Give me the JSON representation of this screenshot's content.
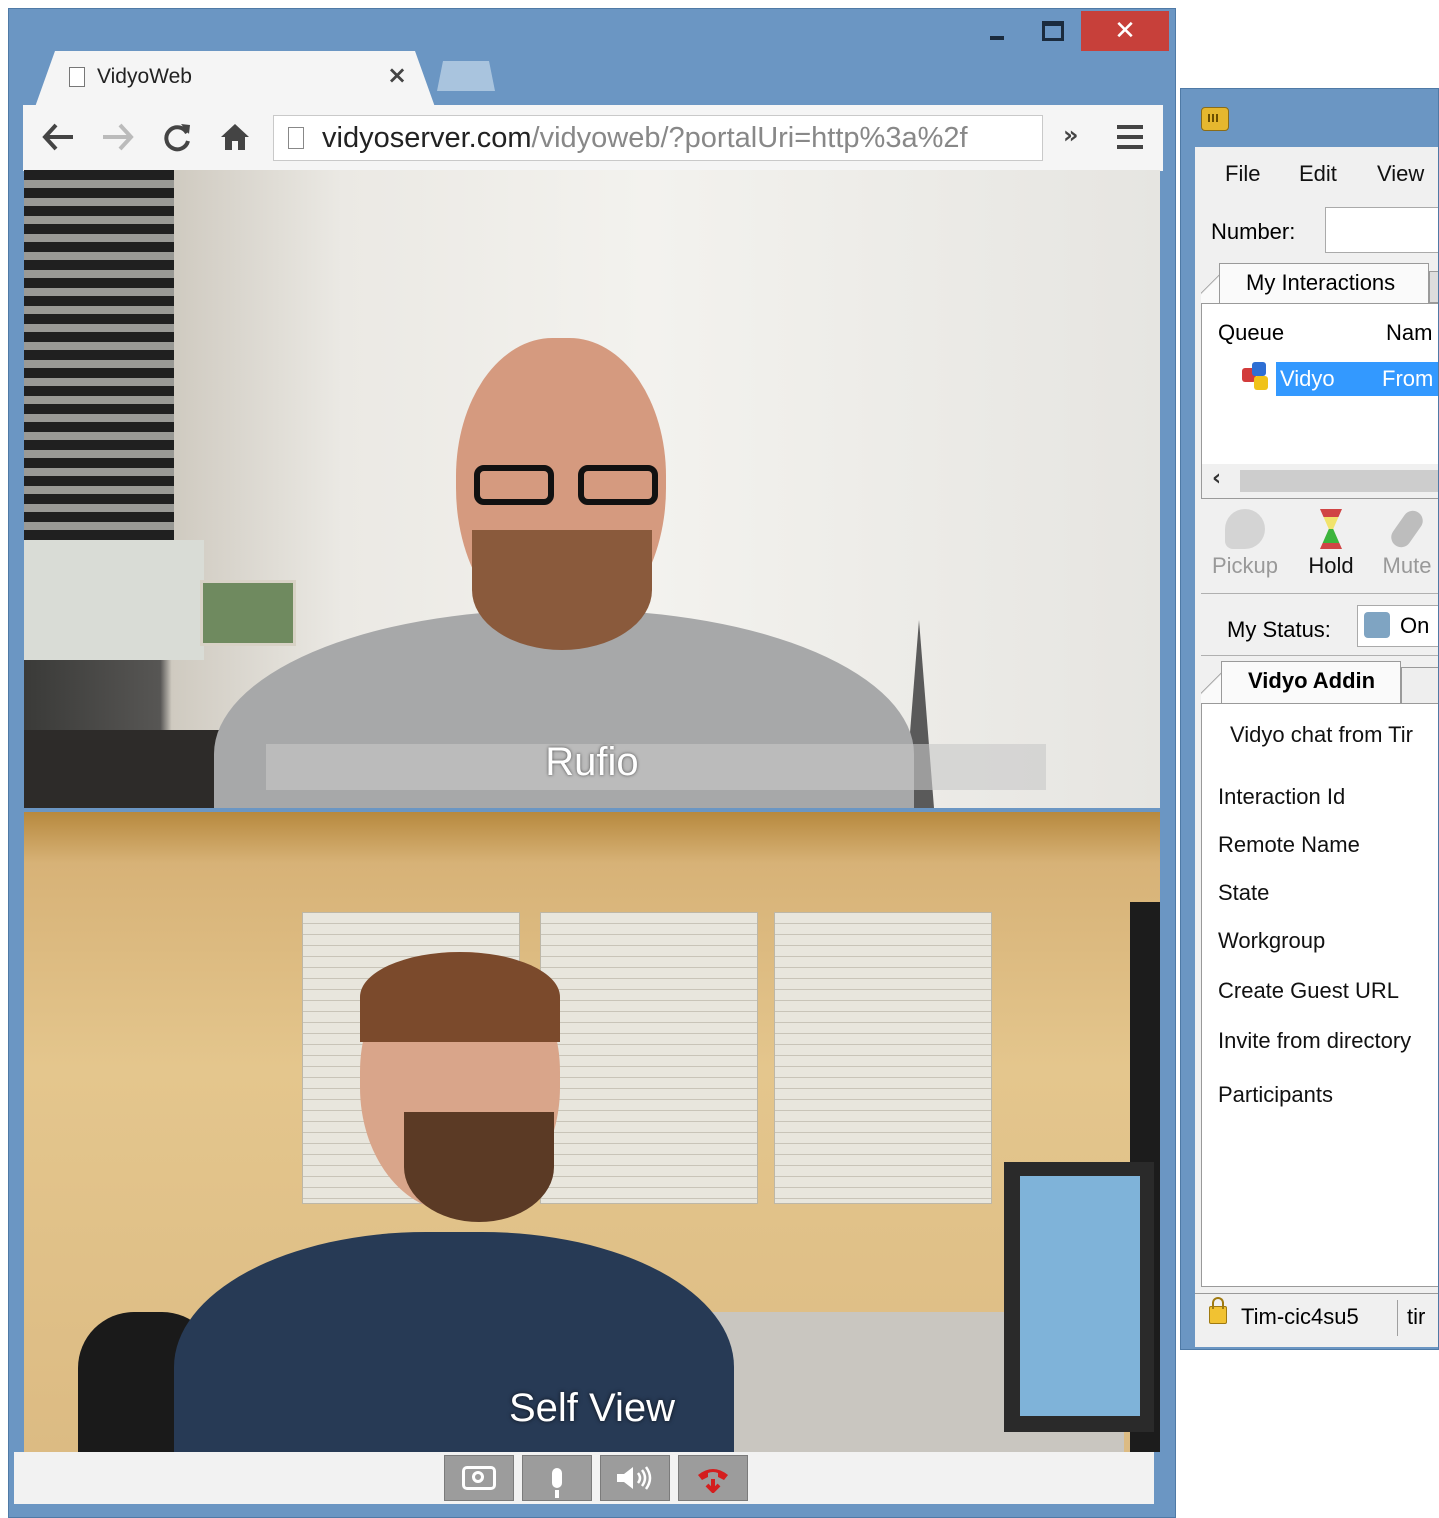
{
  "browser": {
    "tab_title": "VidyoWeb",
    "tab_close": "×",
    "window_close": "✕",
    "address_host": "vidyoserver.com",
    "address_path": "/vidyoweb/?portalUri=http%3a%2f",
    "extensions_chevron": "»"
  },
  "video": {
    "remote_label": "Rufio",
    "self_label": "Self View"
  },
  "call_controls": [
    "camera-icon",
    "microphone-icon",
    "speaker-icon",
    "hangup-icon"
  ],
  "client": {
    "menu": {
      "file": "File",
      "edit": "Edit",
      "view": "View"
    },
    "number_label": "Number:",
    "tab_my_interactions": "My Interactions",
    "columns": {
      "queue": "Queue",
      "name": "Nam"
    },
    "row": {
      "queue": "Vidyo",
      "name": "From"
    },
    "actions": {
      "pickup": "Pickup",
      "hold": "Hold",
      "mute": "Mute"
    },
    "status_label": "My Status:",
    "status_value": "On",
    "tab_addin": "Vidyo Addin",
    "addin": {
      "chat_from": "Vidyo chat from Tir",
      "fields": {
        "interaction_id": "Interaction Id",
        "remote_name": "Remote Name",
        "state": "State",
        "workgroup": "Workgroup",
        "create_guest_url": "Create Guest URL",
        "invite_from_directory": "Invite from directory",
        "participants": "Participants"
      }
    },
    "statusbar": {
      "station": "Tim-cic4su5",
      "user": "tir"
    }
  },
  "colors": {
    "window_frame": "#6b96c3",
    "close_button": "#c7403a",
    "selection": "#3399ff",
    "hangup": "#d41e1e"
  }
}
